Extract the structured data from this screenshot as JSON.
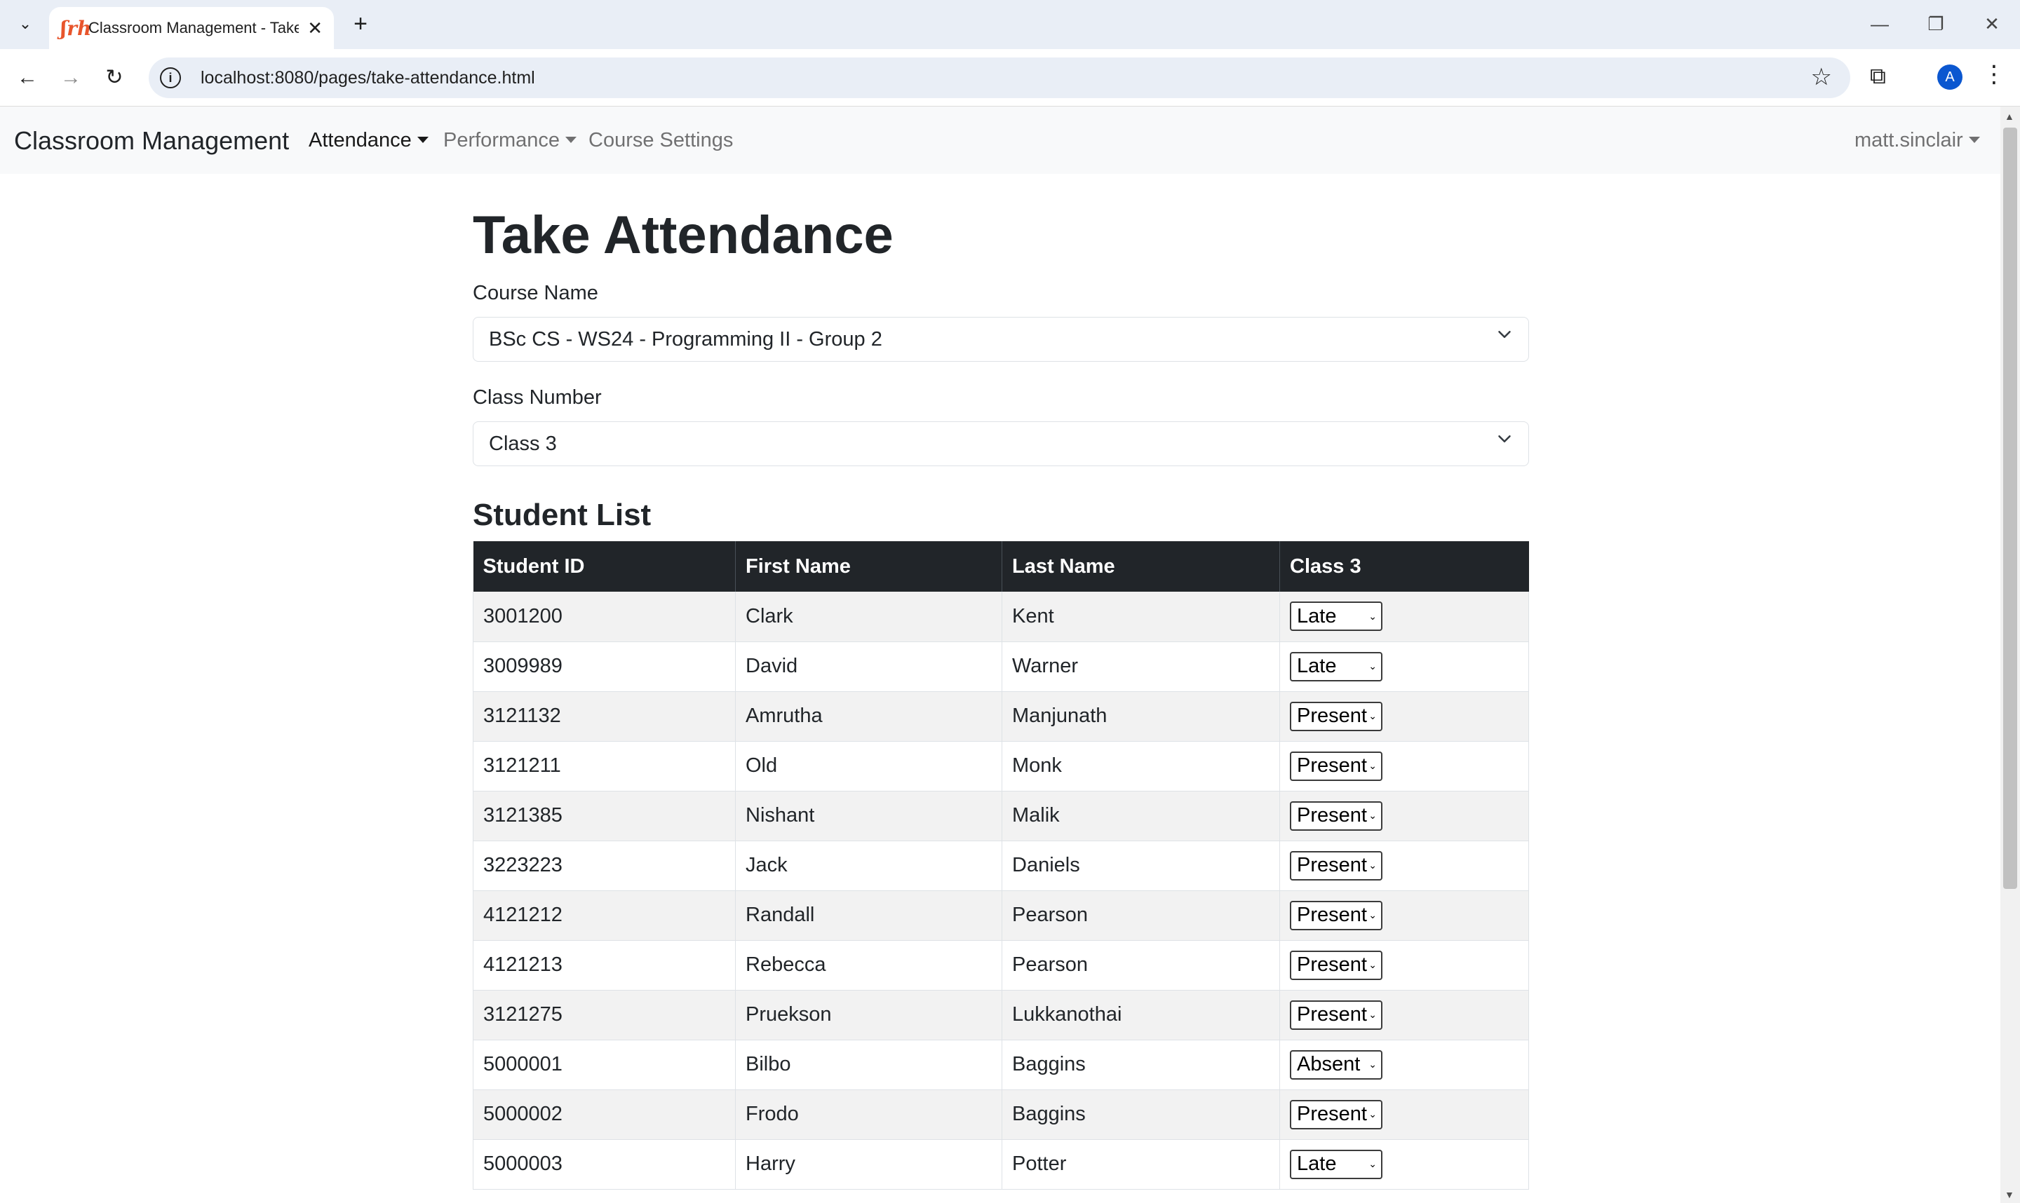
{
  "browser": {
    "tab_title": "Classroom Management - Take Attendance",
    "tab_favicon": "ʃrh",
    "url": "localhost:8080/pages/take-attendance.html",
    "profile_initial": "A"
  },
  "navbar": {
    "brand": "Classroom Management",
    "attendance": "Attendance",
    "performance": "Performance",
    "course_settings": "Course Settings",
    "user": "matt.sinclair"
  },
  "page": {
    "title": "Take Attendance",
    "course_label": "Course Name",
    "course_value": "BSc CS - WS24 - Programming II - Group 2",
    "class_label": "Class Number",
    "class_value": "Class 3",
    "student_list_title": "Student List"
  },
  "table": {
    "headers": [
      "Student ID",
      "First Name",
      "Last Name",
      "Class 3"
    ],
    "rows": [
      {
        "id": "3001200",
        "first": "Clark",
        "last": "Kent",
        "status": "Late"
      },
      {
        "id": "3009989",
        "first": "David",
        "last": "Warner",
        "status": "Late"
      },
      {
        "id": "3121132",
        "first": "Amrutha",
        "last": "Manjunath",
        "status": "Present"
      },
      {
        "id": "3121211",
        "first": "Old",
        "last": "Monk",
        "status": "Present"
      },
      {
        "id": "3121385",
        "first": "Nishant",
        "last": "Malik",
        "status": "Present"
      },
      {
        "id": "3223223",
        "first": "Jack",
        "last": "Daniels",
        "status": "Present"
      },
      {
        "id": "4121212",
        "first": "Randall",
        "last": "Pearson",
        "status": "Present"
      },
      {
        "id": "4121213",
        "first": "Rebecca",
        "last": "Pearson",
        "status": "Present"
      },
      {
        "id": "3121275",
        "first": "Pruekson",
        "last": "Lukkanothai",
        "status": "Present"
      },
      {
        "id": "5000001",
        "first": "Bilbo",
        "last": "Baggins",
        "status": "Absent"
      },
      {
        "id": "5000002",
        "first": "Frodo",
        "last": "Baggins",
        "status": "Present"
      },
      {
        "id": "5000003",
        "first": "Harry",
        "last": "Potter",
        "status": "Late"
      }
    ]
  }
}
